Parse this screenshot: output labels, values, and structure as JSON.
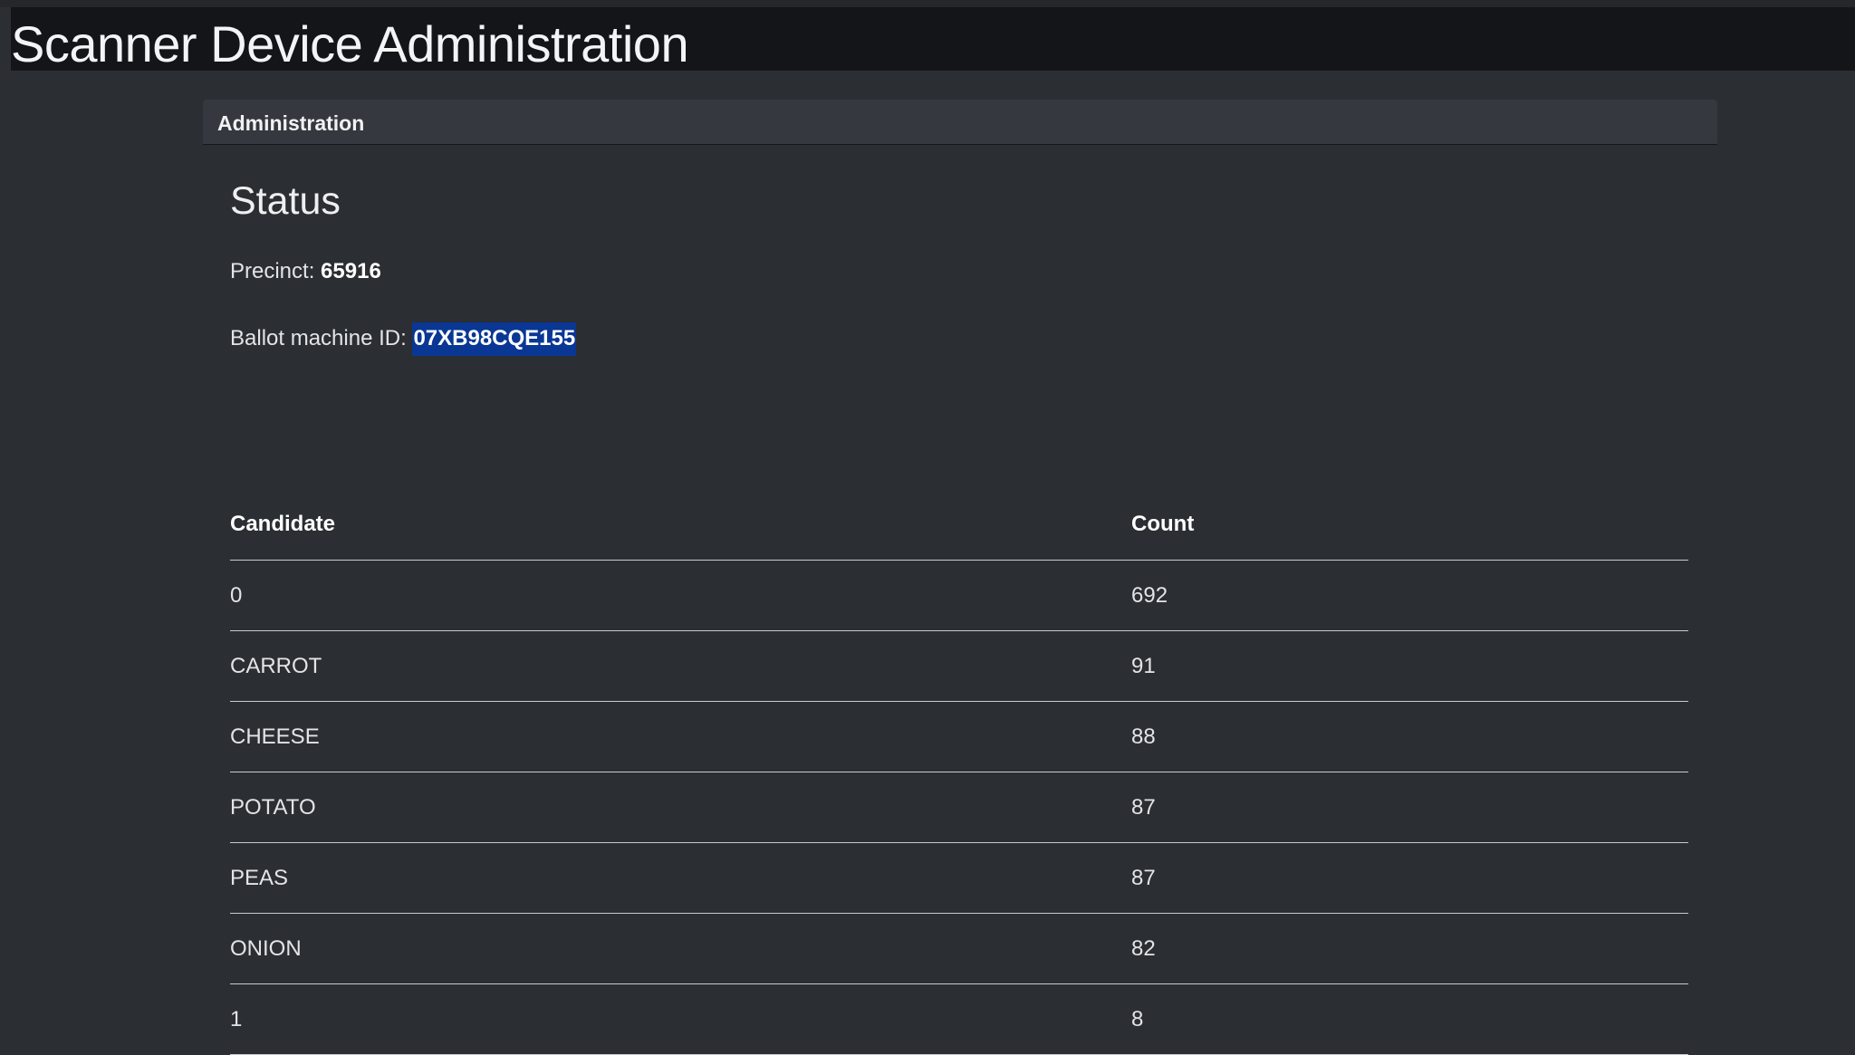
{
  "app": {
    "title": "Scanner Device Administration"
  },
  "card": {
    "header": "Administration",
    "status_title": "Status",
    "precinct_label": "Precinct:",
    "precinct_value": "65916",
    "machine_label": "Ballot machine ID:",
    "machine_value": "07XB98CQE155"
  },
  "table": {
    "headers": {
      "candidate": "Candidate",
      "count": "Count"
    },
    "rows": [
      {
        "candidate": "0",
        "count": "692"
      },
      {
        "candidate": "CARROT",
        "count": "91"
      },
      {
        "candidate": "CHEESE",
        "count": "88"
      },
      {
        "candidate": "POTATO",
        "count": "87"
      },
      {
        "candidate": "PEAS",
        "count": "87"
      },
      {
        "candidate": "ONION",
        "count": "82"
      },
      {
        "candidate": "1",
        "count": "8"
      }
    ]
  },
  "colors": {
    "background": "#2b2e33",
    "title_bar": "#131519",
    "card_header": "#35383e",
    "selection_highlight": "#0a3794"
  }
}
